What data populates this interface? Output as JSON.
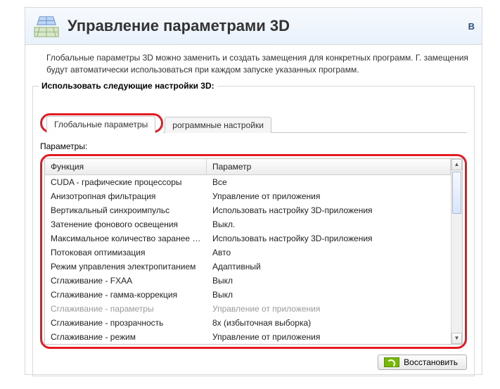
{
  "header": {
    "title": "Управление параметрами 3D",
    "right_char": "В"
  },
  "description": "Глобальные параметры 3D можно заменить и создать замещения для конкретных программ. Г. замещения будут автоматически использоваться при каждом запуске указанных программ.",
  "group_title": "Использовать следующие настройки 3D:",
  "tabs": {
    "global": "Глобальные параметры",
    "program": "рограммные настройки"
  },
  "params_label": "Параметры:",
  "columns": {
    "func": "Функция",
    "param": "Параметр"
  },
  "rows": [
    {
      "f": "CUDA - графические процессоры",
      "p": "Все"
    },
    {
      "f": "Анизотропная фильтрация",
      "p": "Управление от приложения"
    },
    {
      "f": "Вертикальный синхроимпульс",
      "p": "Использовать настройку 3D-приложения"
    },
    {
      "f": "Затенение фонового освещения",
      "p": "Выкл."
    },
    {
      "f": "Максимальное количество заранее под...",
      "p": "Использовать настройку 3D-приложения"
    },
    {
      "f": "Потоковая оптимизация",
      "p": "Авто"
    },
    {
      "f": "Режим управления электропитанием",
      "p": "Адаптивный"
    },
    {
      "f": "Сглаживание - FXAA",
      "p": "Выкл"
    },
    {
      "f": "Сглаживание - гамма-коррекция",
      "p": "Выкл"
    },
    {
      "f": "Сглаживание - параметры",
      "p": "Управление от приложения",
      "disabled": true
    },
    {
      "f": "Сглаживание - прозрачность",
      "p": "8x (избыточная выборка)"
    },
    {
      "f": "Сглаживание - режим",
      "p": "Управление от приложения"
    }
  ],
  "restore_button": "Восстановить"
}
